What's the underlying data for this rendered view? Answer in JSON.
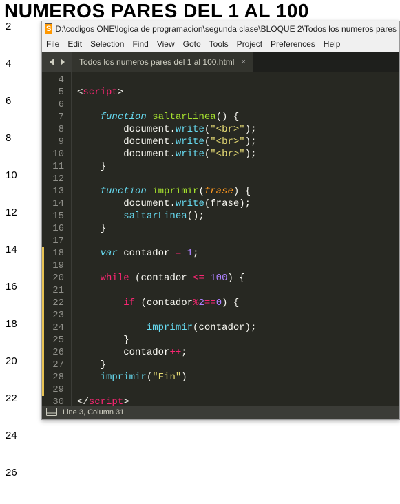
{
  "page": {
    "heading": "NUMEROS PARES DEL 1 AL 100",
    "left_numbers": [
      "2",
      "4",
      "6",
      "8",
      "10",
      "12",
      "14",
      "16",
      "18",
      "20",
      "22",
      "24",
      "26"
    ]
  },
  "window": {
    "title": "D:\\codigos ONE\\logica de programacion\\segunda clase\\BLOQUE 2\\Todos los numeros pares",
    "menu": {
      "file": "File",
      "edit": "Edit",
      "selection": "Selection",
      "find": "Find",
      "view": "View",
      "goto": "Goto",
      "tools": "Tools",
      "project": "Project",
      "preferences": "Preferences",
      "help": "Help"
    },
    "tab": {
      "label": "Todos los numeros pares del 1 al 100.html",
      "close": "×"
    },
    "status": {
      "position": "Line 3, Column 31"
    }
  },
  "code": {
    "gutter": [
      "4",
      "5",
      "6",
      "7",
      "8",
      "9",
      "10",
      "11",
      "12",
      "13",
      "14",
      "15",
      "16",
      "17",
      "18",
      "19",
      "20",
      "21",
      "22",
      "23",
      "24",
      "25",
      "26",
      "27",
      "28",
      "29",
      "30"
    ],
    "modified": [
      14,
      15,
      16,
      17,
      18,
      19,
      20,
      21,
      22,
      23,
      24,
      25
    ],
    "tokens": {
      "lt": "<",
      "gt": ">",
      "lts": "</",
      "script": "script",
      "function": "function",
      "saltarLinea": "saltarLinea",
      "lpar": "(",
      "rpar": ")",
      "lbr": "{",
      "rbr": "}",
      "document": "document",
      "dot": ".",
      "write": "write",
      "brstr": "\"<br>\"",
      "semi": ";",
      "imprimir": "imprimir",
      "frase": "frase",
      "var": "var",
      "contador": "contador",
      "eq": "=",
      "one": "1",
      "while": "while",
      "le": "<=",
      "hundred": "100",
      "if": "if",
      "mod": "%",
      "two": "2",
      "eqeq": "==",
      "zero": "0",
      "pp": "++",
      "finstr": "\"Fin\""
    }
  }
}
